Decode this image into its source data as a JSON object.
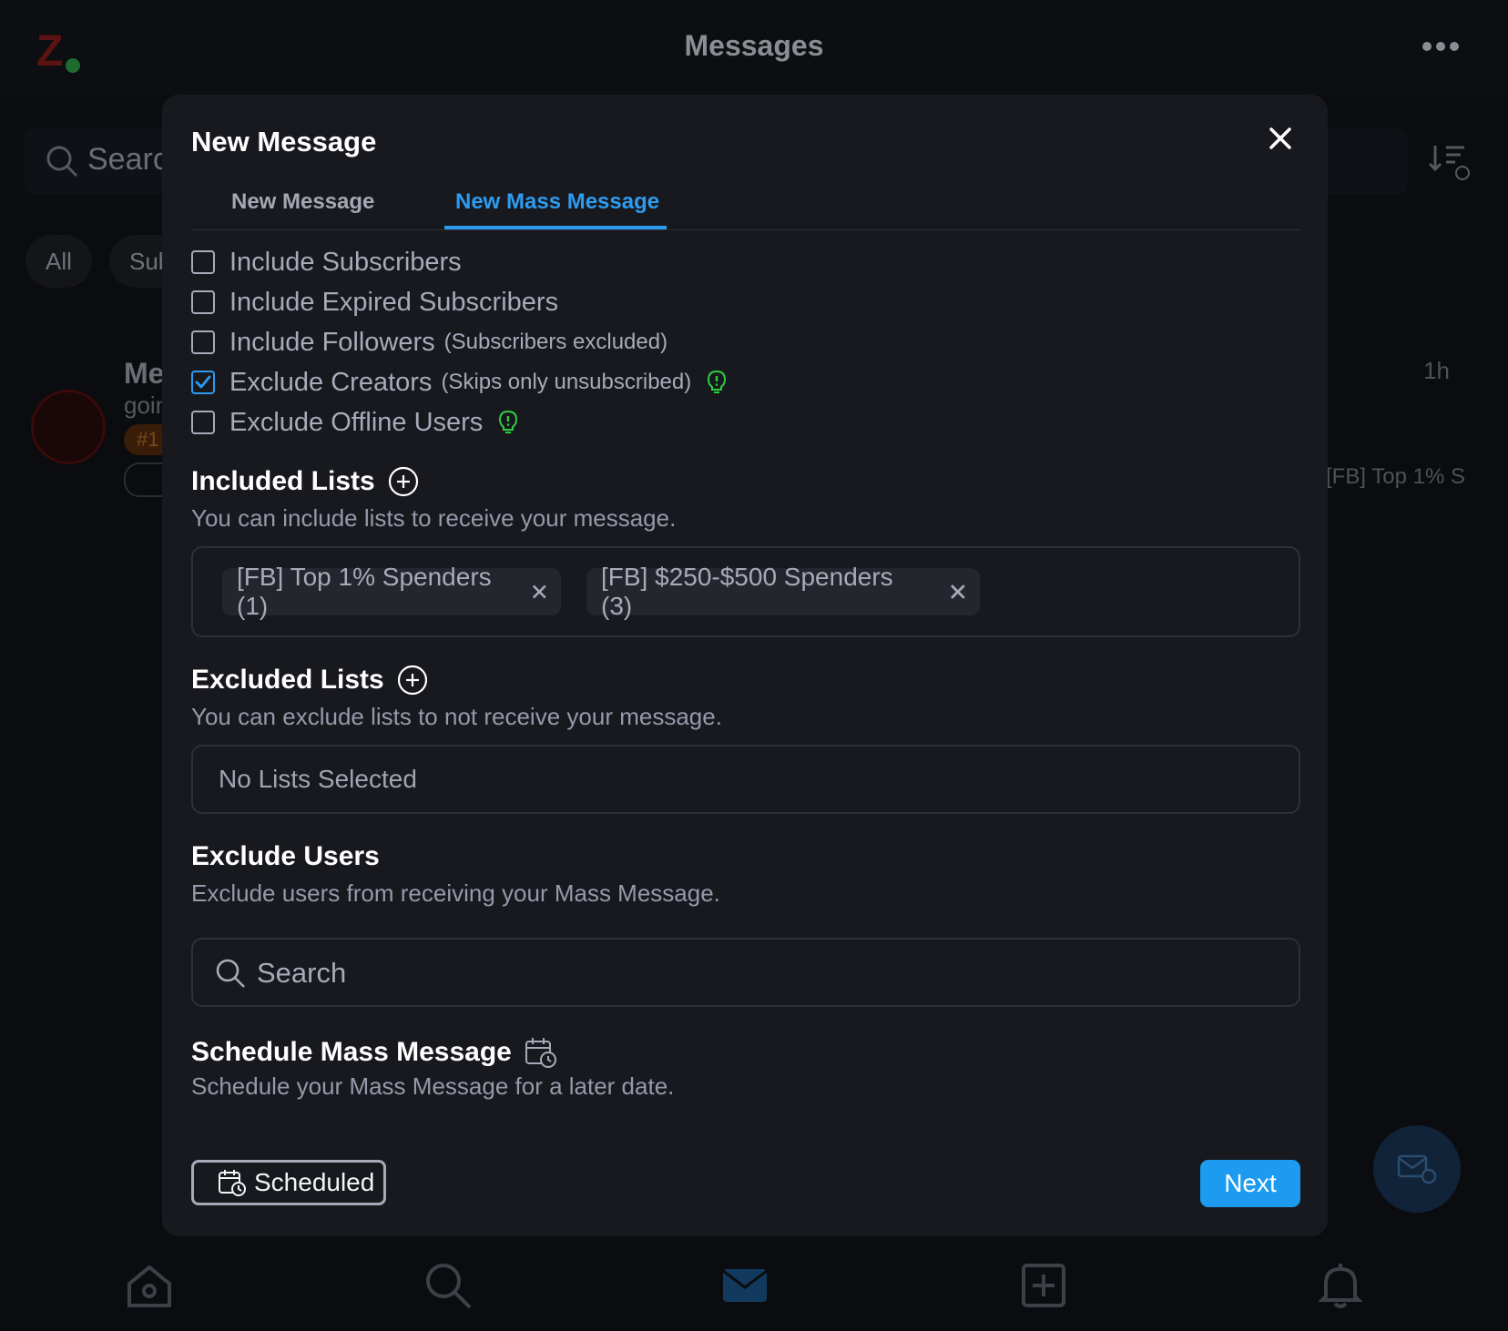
{
  "app": {
    "title": "Messages",
    "search_placeholder": "Search",
    "filter_chips": [
      "All",
      "Sub"
    ],
    "conversation": {
      "name": "Me",
      "preview": "goin",
      "badge": "#1",
      "time": "1h",
      "list_tag": "[FB] Top 1% S"
    }
  },
  "modal": {
    "title": "New Message",
    "tabs": [
      {
        "label": "New Message",
        "active": false
      },
      {
        "label": "New Mass Message",
        "active": true
      }
    ],
    "options": [
      {
        "label": "Include Subscribers",
        "note": "",
        "checked": false
      },
      {
        "label": "Include Expired Subscribers",
        "note": "",
        "checked": false
      },
      {
        "label": "Include Followers",
        "note": "(Subscribers excluded)",
        "checked": false
      },
      {
        "label": "Exclude Creators",
        "note": "(Skips only unsubscribed)",
        "checked": true,
        "hint": true
      },
      {
        "label": "Exclude Offline Users",
        "note": "",
        "checked": false,
        "hint": true
      }
    ],
    "included_lists": {
      "title": "Included Lists",
      "description": "You can include lists to receive your message.",
      "items": [
        "[FB] Top 1% Spenders (1)",
        "[FB] $250-$500 Spenders (3)"
      ]
    },
    "excluded_lists": {
      "title": "Excluded Lists",
      "description": "You can exclude lists to not receive your message.",
      "empty_text": "No Lists Selected"
    },
    "exclude_users": {
      "title": "Exclude Users",
      "description": "Exclude users from receiving your Mass Message.",
      "search_placeholder": "Search",
      "search_value": ""
    },
    "schedule": {
      "title": "Schedule Mass Message",
      "description": "Schedule your Mass Message for a later date."
    },
    "buttons": {
      "scheduled": "Scheduled",
      "next": "Next"
    }
  },
  "colors": {
    "accent": "#2d9cf0",
    "primary_button": "#1d9bf0",
    "hint_green": "#2ecc40",
    "modal_bg": "#18191e",
    "page_bg": "#0b0c0f"
  },
  "icons": [
    "logo-icon",
    "more-icon",
    "search-icon",
    "sort-icon",
    "close-icon",
    "checkbox-icon",
    "check-icon",
    "lightbulb-icon",
    "add-circle-icon",
    "x-icon",
    "calendar-clock-icon",
    "home-icon",
    "mail-icon",
    "plus-square-icon",
    "bell-icon",
    "compose-mail-icon"
  ]
}
